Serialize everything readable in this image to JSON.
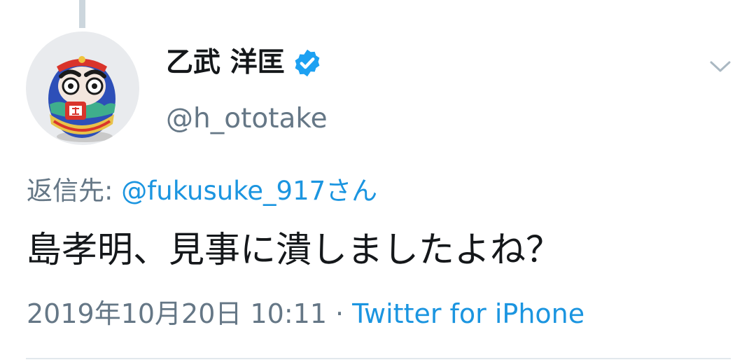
{
  "tweet": {
    "author": {
      "name": "乙武 洋匡",
      "handle": "@h_ototake",
      "verified": true,
      "avatar_icon": "daruma-avatar"
    },
    "reply": {
      "prefix": "返信先:",
      "mention": "@fukusuke_917さん"
    },
    "text": "島孝明、見事に潰しましたよね？",
    "timestamp": "2019年10月20日 10:11",
    "separator": "·",
    "source": "Twitter for iPhone"
  },
  "colors": {
    "text": "#14171a",
    "secondary": "#657786",
    "link": "#1b95e0",
    "verified": "#1da1f2",
    "divider": "#e1e8ed"
  },
  "icons": {
    "verified": "verified-badge-icon",
    "menu": "chevron-down-icon"
  }
}
